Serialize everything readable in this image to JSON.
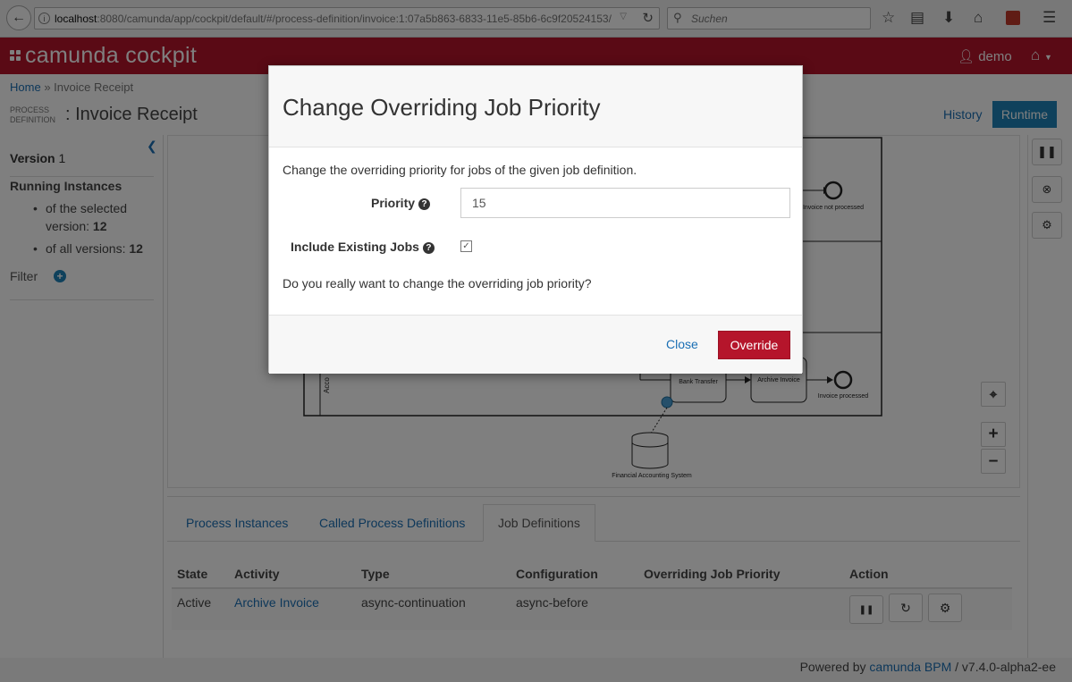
{
  "browser": {
    "url_host": "localhost",
    "url_rest": ":8080/camunda/app/cockpit/default/#/process-definition/invoice:1:07a5b863-6833-11e5-85b6-6c9f20524153/",
    "search_placeholder": "Suchen"
  },
  "header": {
    "brand": "camunda cockpit",
    "user": "demo"
  },
  "breadcrumb": {
    "home": "Home",
    "separator": "»",
    "current": "Invoice Receipt"
  },
  "page": {
    "type_label_line1": "PROCESS",
    "type_label_line2": "DEFINITION",
    "title": ": Invoice Receipt"
  },
  "views": {
    "history": "History",
    "runtime": "Runtime"
  },
  "sidebar": {
    "version_label": "Version",
    "version_value": "1",
    "running_title": "Running Instances",
    "selected_label": "of the selected version:",
    "selected_value": "12",
    "all_label": "of all versions:",
    "all_value": "12",
    "filter_label": "Filter"
  },
  "diagram": {
    "labels": {
      "not_processed": "Invoice not processed",
      "bank_transfer": "Bank Transfer",
      "archive": "Archive Invoice",
      "processed": "Invoice processed",
      "financial": "Financial Accounting System",
      "accounting": "Acco"
    }
  },
  "tabs": [
    {
      "label": "Process Instances"
    },
    {
      "label": "Called Process Definitions"
    },
    {
      "label": "Job Definitions"
    }
  ],
  "table": {
    "columns": [
      "State",
      "Activity",
      "Type",
      "Configuration",
      "Overriding Job Priority",
      "Action"
    ],
    "rows": [
      {
        "state": "Active",
        "activity": "Archive Invoice",
        "type": "async-continuation",
        "configuration": "async-before",
        "priority": ""
      }
    ]
  },
  "footer": {
    "powered": "Powered by",
    "product": "camunda BPM",
    "version": "/ v7.4.0-alpha2-ee"
  },
  "modal": {
    "title": "Change Overriding Job Priority",
    "intro": "Change the overriding priority for jobs of the given job definition.",
    "priority_label": "Priority",
    "priority_value": "15",
    "include_label": "Include Existing Jobs",
    "include_checked": true,
    "question": "Do you really want to change the overriding job priority?",
    "close_label": "Close",
    "override_label": "Override"
  },
  "colors": {
    "brand": "#b5152b",
    "link": "#1a6fb4",
    "runtime_button": "#1f82b8"
  }
}
